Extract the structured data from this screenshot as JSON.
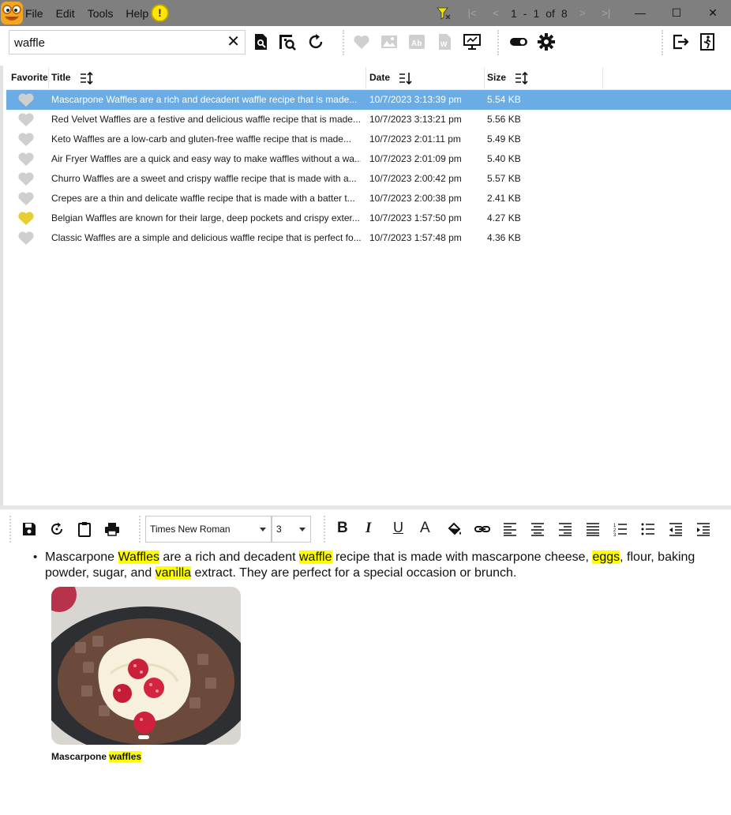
{
  "menu": {
    "items": [
      "File",
      "Edit",
      "Tools",
      "Help"
    ],
    "alert_glyph": "!"
  },
  "pager": {
    "current_start": "1",
    "separator": "-",
    "current_end": "1",
    "of_label": "of",
    "total": "8"
  },
  "window_controls": {
    "minimize": "—",
    "maximize": "☐",
    "close": "✕"
  },
  "search": {
    "value": "waffle",
    "clear_glyph": "✕"
  },
  "table": {
    "headers": {
      "favorite": "Favorite",
      "title": "Title",
      "date": "Date",
      "size": "Size"
    },
    "rows": [
      {
        "favorite": false,
        "title": "Mascarpone Waffles are a rich and decadent waffle recipe that is made...",
        "date": "10/7/2023 3:13:39 pm",
        "size": "5.54 KB",
        "selected": true
      },
      {
        "favorite": false,
        "title": "Red Velvet Waffles are a festive and delicious waffle recipe that is made...",
        "date": "10/7/2023 3:13:21 pm",
        "size": "5.56 KB",
        "selected": false
      },
      {
        "favorite": false,
        "title": "Keto Waffles are a low-carb and gluten-free waffle recipe that is made...",
        "date": "10/7/2023 2:01:11 pm",
        "size": "5.49 KB",
        "selected": false
      },
      {
        "favorite": false,
        "title": "Air Fryer Waffles are a quick and easy way to make waffles without a wa...",
        "date": "10/7/2023 2:01:09 pm",
        "size": "5.40 KB",
        "selected": false
      },
      {
        "favorite": false,
        "title": "Churro Waffles are a sweet and crispy waffle recipe that is made with a...",
        "date": "10/7/2023 2:00:42 pm",
        "size": "5.57 KB",
        "selected": false
      },
      {
        "favorite": false,
        "title": "Crepes are a thin and delicate waffle recipe that is made with a batter t...",
        "date": "10/7/2023 2:00:38 pm",
        "size": "2.41 KB",
        "selected": false
      },
      {
        "favorite": true,
        "title": "Belgian Waffles are known for their large, deep pockets and crispy exter...",
        "date": "10/7/2023 1:57:50 pm",
        "size": "4.27 KB",
        "selected": false
      },
      {
        "favorite": false,
        "title": "Classic Waffles are a simple and delicious waffle recipe that is perfect fo...",
        "date": "10/7/2023 1:57:48 pm",
        "size": "4.36 KB",
        "selected": false
      }
    ]
  },
  "editor_toolbar": {
    "font_family": "Times New Roman",
    "font_size": "3",
    "bold_glyph": "B",
    "italic_glyph": "I",
    "underline_glyph": "U",
    "font_color_glyph": "A"
  },
  "editor": {
    "bullet": "•",
    "paragraph_segments": [
      {
        "text": "Mascarpone ",
        "highlight": false
      },
      {
        "text": "Waffles",
        "highlight": true
      },
      {
        "text": " are a rich and decadent ",
        "highlight": false
      },
      {
        "text": "waffle",
        "highlight": true
      },
      {
        "text": " recipe that is made with mascarpone cheese, ",
        "highlight": false
      },
      {
        "text": "eggs",
        "highlight": true
      },
      {
        "text": ", flour, baking powder, sugar, and ",
        "highlight": false
      },
      {
        "text": "vanilla",
        "highlight": true
      },
      {
        "text": " extract. They are perfect for a special occasion or brunch.",
        "highlight": false
      }
    ],
    "caption_plain": "Mascarpone ",
    "caption_highlight": "waffles"
  },
  "colors": {
    "titlebar": "#7f7f7f",
    "selection": "#6aace3",
    "highlight": "#ffff00",
    "favorite_on": "#e6cf2f",
    "favorite_off": "#cfcfcf",
    "alert": "#ffe600"
  }
}
